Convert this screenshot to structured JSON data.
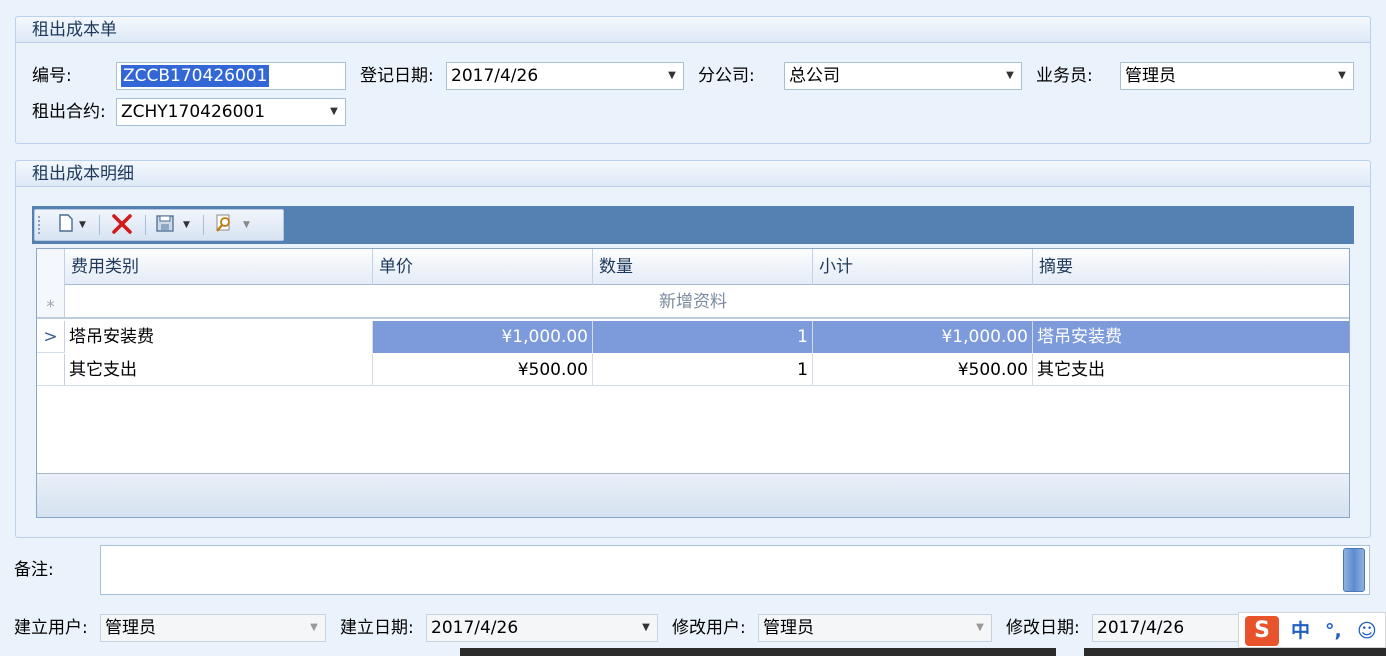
{
  "header_group": {
    "title": "租出成本单",
    "number_label": "编号:",
    "number_value": "ZCCB170426001",
    "reg_date_label": "登记日期:",
    "reg_date_value": "2017/4/26",
    "branch_label": "分公司:",
    "branch_value": "总公司",
    "salesman_label": "业务员:",
    "salesman_value": "管理员",
    "contract_label": "租出合约:",
    "contract_value": "ZCHY170426001"
  },
  "detail_group": {
    "title": "租出成本明细",
    "toolbar": {
      "new_icon": "new-document-icon",
      "delete_icon": "delete-x-icon",
      "save_icon": "save-disk-icon",
      "search_icon": "search-magnifier-icon"
    },
    "columns": [
      "费用类别",
      "单价",
      "数量",
      "小计",
      "摘要"
    ],
    "new_row_text": "新增资料",
    "rows": [
      {
        "category": "塔吊安装费",
        "unit_price": "¥1,000.00",
        "qty": "1",
        "subtotal": "¥1,000.00",
        "summary": "塔吊安装费"
      },
      {
        "category": "其它支出",
        "unit_price": "¥500.00",
        "qty": "1",
        "subtotal": "¥500.00",
        "summary": "其它支出"
      }
    ]
  },
  "memo": {
    "label": "备注:",
    "value": ""
  },
  "footer": {
    "created_user_label": "建立用户:",
    "created_user_value": "管理员",
    "created_date_label": "建立日期:",
    "created_date_value": "2017/4/26",
    "modified_user_label": "修改用户:",
    "modified_user_value": "管理员",
    "modified_date_label": "修改日期:",
    "modified_date_value": "2017/4/26"
  },
  "ime": {
    "logo": "S",
    "mode": "中",
    "punct": "°,",
    "emoji": "☺"
  },
  "colors": {
    "selected_row": "#7d9bdb",
    "toolbar_bg": "#5580b2",
    "selection": "#3367d6"
  }
}
